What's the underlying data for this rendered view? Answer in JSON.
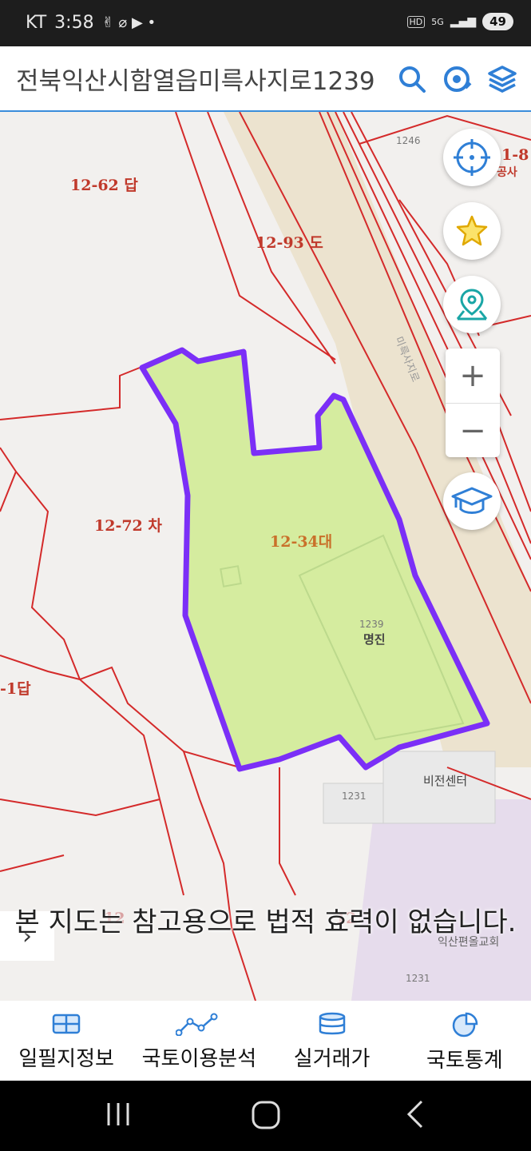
{
  "status_bar": {
    "carrier": "KT",
    "time": "3:58",
    "battery": "49",
    "network": "5G",
    "hd": "HD"
  },
  "search": {
    "address": "전북익산시함열읍미륵사지로1239"
  },
  "map": {
    "parcel_labels": [
      "12-62 답",
      "12-93 도",
      "12-72 차",
      "12-34대",
      "-1답",
      "1-8",
      "공사"
    ],
    "building_labels": [
      "1246",
      "1239",
      "명진",
      "1231",
      "비전센터",
      "1231",
      "익산편올교회",
      "12",
      "12"
    ],
    "road_label": "미륵사지로",
    "highlight_color": "#7b2ff7",
    "highlight_fill": "#d5ec9f",
    "boundary_color": "#d42a2a"
  },
  "notice": "본 지도는 참고용으로 법적 효력이 없습니다.",
  "tabs": [
    {
      "label": "일필지정보",
      "icon": "map-grid-icon"
    },
    {
      "label": "국토이용분석",
      "icon": "line-chart-icon"
    },
    {
      "label": "실거래가",
      "icon": "database-icon"
    },
    {
      "label": "국토통계",
      "icon": "pie-chart-icon"
    }
  ]
}
